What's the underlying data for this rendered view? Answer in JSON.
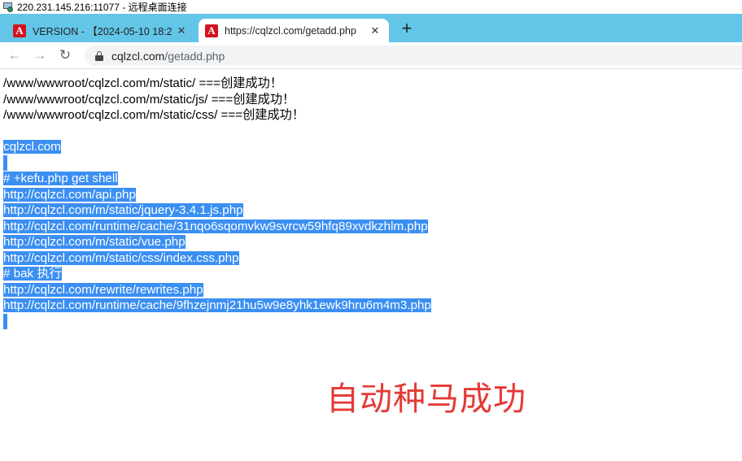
{
  "rdp": {
    "title": "220.231.145.216:11077 - 远程桌面连接"
  },
  "tabs": [
    {
      "title": "VERSION - 【2024-05-10 18:2",
      "active": false
    },
    {
      "title": "https://cqlzcl.com/getadd.php",
      "active": true
    }
  ],
  "toolbar": {
    "url_host": "cqlzcl.com",
    "url_path": "/getadd.php"
  },
  "page": {
    "created_lines": [
      "/www/wwwroot/cqlzcl.com/m/static/ ===创建成功！",
      "/www/wwwroot/cqlzcl.com/m/static/js/ ===创建成功！",
      "/www/wwwroot/cqlzcl.com/m/static/css/ ===创建成功！"
    ],
    "domain": "cqlzcl.com",
    "selected_lines": [
      "# +kefu.php get shell",
      "http://cqlzcl.com/api.php",
      "http://cqlzcl.com/m/static/jquery-3.4.1.js.php",
      "http://cqlzcl.com/runtime/cache/31nqo6sqomvkw9svrcw59hfq89xvdkzhlm.php",
      "http://cqlzcl.com/m/static/vue.php",
      "http://cqlzcl.com/m/static/css/index.css.php",
      "# bak 执行",
      "http://cqlzcl.com/rewrite/rewrites.php",
      "http://cqlzcl.com/runtime/cache/9fhzejnmj21hu5w9e8yhk1ewk9hru6m4m3.php"
    ]
  },
  "overlay_text": "自动种马成功",
  "colors": {
    "tabstrip": "#63c6e8",
    "selection": "#3b8ff2",
    "overlay": "#e53935",
    "favicon": "#d4121f"
  }
}
